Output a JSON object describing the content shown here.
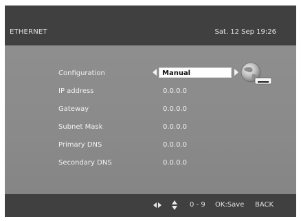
{
  "header": {
    "title": "ETHERNET",
    "datetime": "Sat. 12 Sep 19:26"
  },
  "settings": {
    "rows": [
      {
        "label": "Configuration",
        "value": "Manual"
      },
      {
        "label": "IP address",
        "value": "0.0.0.0"
      },
      {
        "label": "Gateway",
        "value": "0.0.0.0"
      },
      {
        "label": "Subnet Mask",
        "value": "0.0.0.0"
      },
      {
        "label": "Primary DNS",
        "value": "0.0.0.0"
      },
      {
        "label": "Secondary DNS",
        "value": "0.0.0.0"
      }
    ],
    "icon": "network-globe-icon"
  },
  "footer": {
    "icons": [
      "left-right-arrows-icon",
      "up-down-arrows-icon"
    ],
    "digits_hint": "0 - 9",
    "save_hint": "OK:Save",
    "back_hint": "BACK"
  },
  "colors": {
    "header_bg": "#404040",
    "content_bg": "#8a8a8a",
    "text": "#f2f2f2",
    "selected_bg": "#ffffff"
  }
}
